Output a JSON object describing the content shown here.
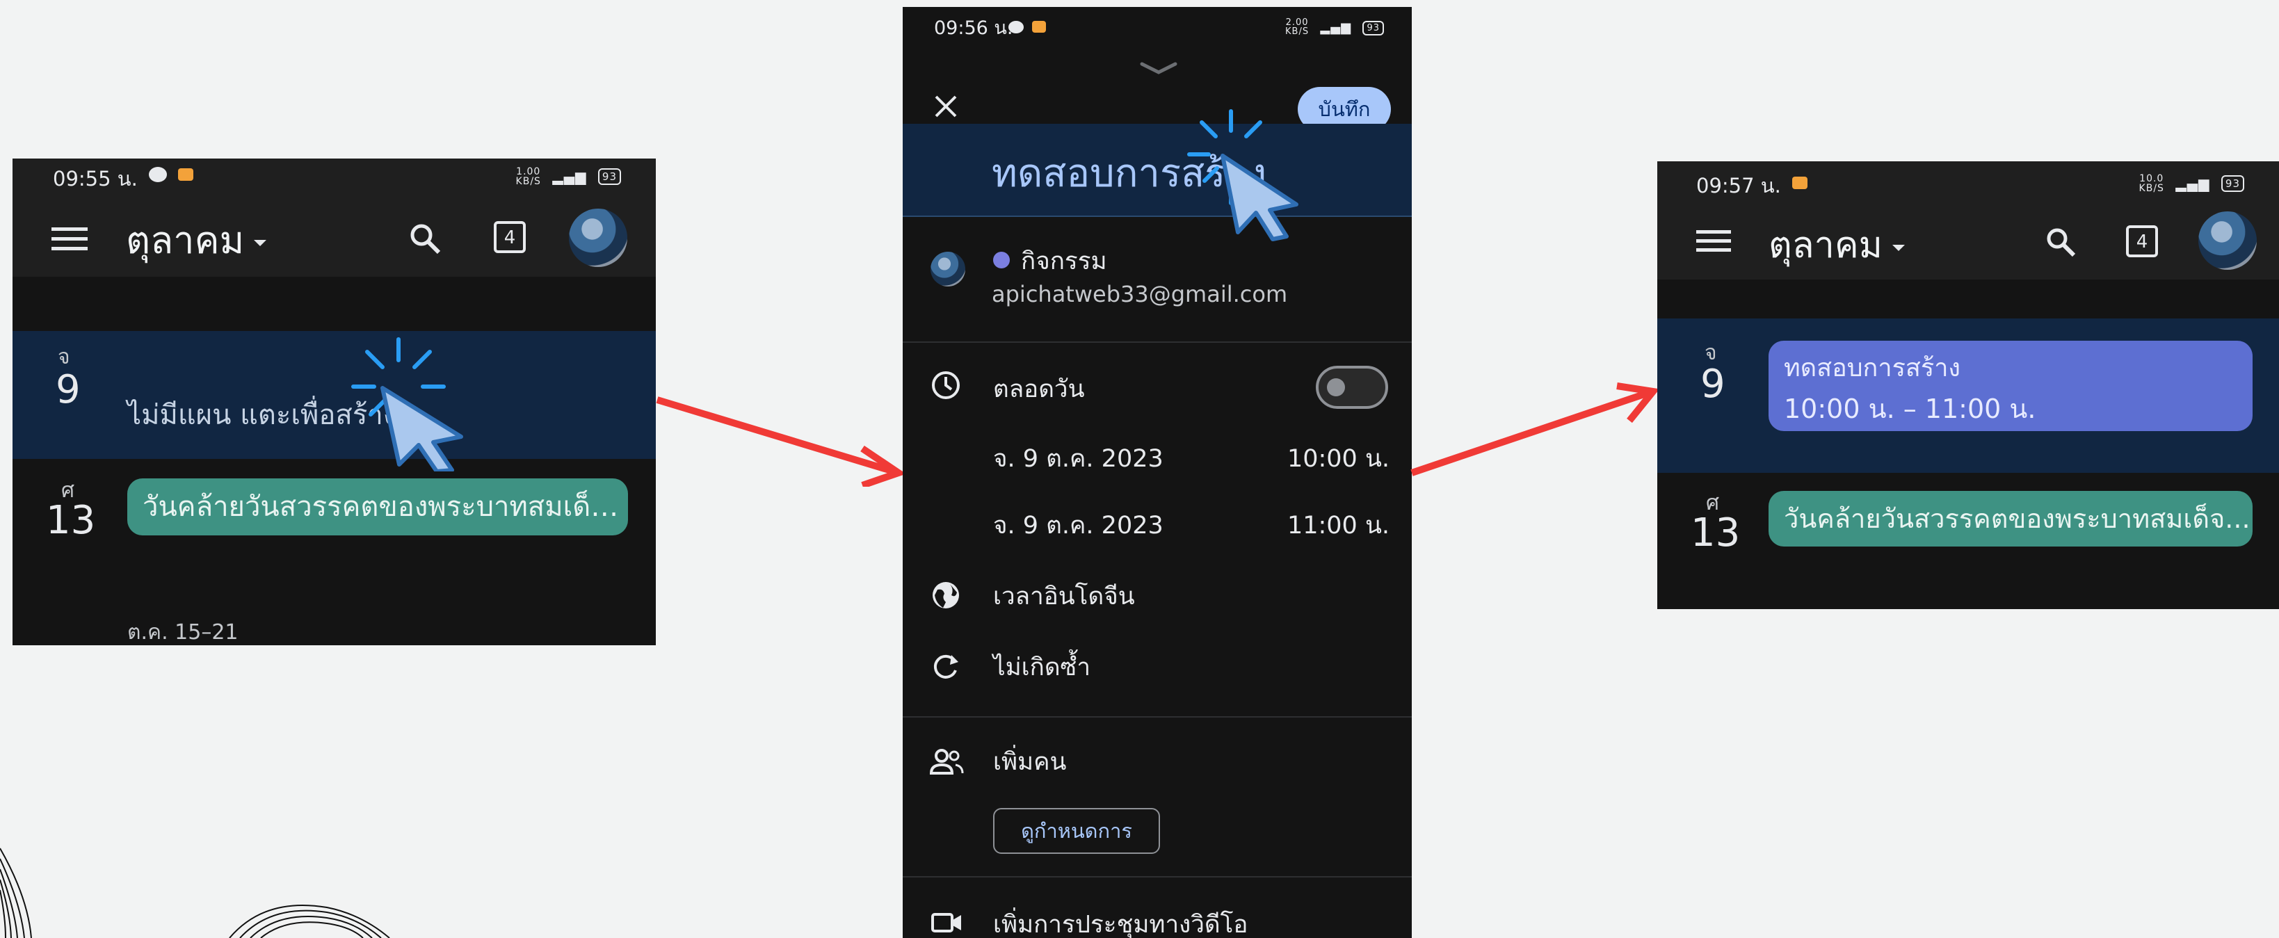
{
  "panel_left": {
    "status": {
      "time": "09:55 น.",
      "speed_top": "1.00",
      "speed_bottom": "KB/S",
      "battery": "93"
    },
    "month": "ตุลาคม",
    "today_badge": "4",
    "rows": [
      {
        "dow": "จ",
        "day": "9",
        "text": "ไม่มีแผน แตะเพื่อสร้าง"
      },
      {
        "dow": "ศ",
        "day": "13",
        "event": "วันคล้ายวันสวรรคตของพระบาทสมเด็จ..."
      }
    ],
    "week_label": "ต.ค. 15–21"
  },
  "panel_middle": {
    "status": {
      "time": "09:56 น.",
      "speed_top": "2.00",
      "speed_bottom": "KB/S",
      "battery": "93"
    },
    "save_label": "บันทึก",
    "title_value": "ทดสอบการสร้าง",
    "calendar_type": "กิจกรรม",
    "account": "apichatweb33@gmail.com",
    "all_day_label": "ตลอดวัน",
    "start_date": "จ. 9 ต.ค. 2023",
    "start_time": "10:00 น.",
    "end_date": "จ. 9 ต.ค. 2023",
    "end_time": "11:00 น.",
    "timezone": "เวลาอินโดจีน",
    "repeat": "ไม่เกิดซ้ำ",
    "add_people": "เพิ่มคน",
    "view_schedule": "ดูกำหนดการ",
    "add_video": "เพิ่มการประชุมทางวิดีโอ",
    "accent_color": "#7b7fe0"
  },
  "panel_right": {
    "status": {
      "time": "09:57 น.",
      "speed_top": "10.0",
      "speed_bottom": "KB/S",
      "battery": "93"
    },
    "month": "ตุลาคม",
    "today_badge": "4",
    "rows": [
      {
        "dow": "จ",
        "day": "9",
        "event_title": "ทดสอบการสร้าง",
        "event_time": "10:00 น. – 11:00 น."
      },
      {
        "dow": "ศ",
        "day": "13",
        "event": "วันคล้ายวันสวรรคตของพระบาทสมเด็จ..."
      }
    ]
  },
  "colors": {
    "arrow": "#f03a36",
    "highlight_row": "#112642",
    "green_event": "#3e9283",
    "blue_event": "#5d6fd2",
    "save_button": "#a8c7fa"
  }
}
